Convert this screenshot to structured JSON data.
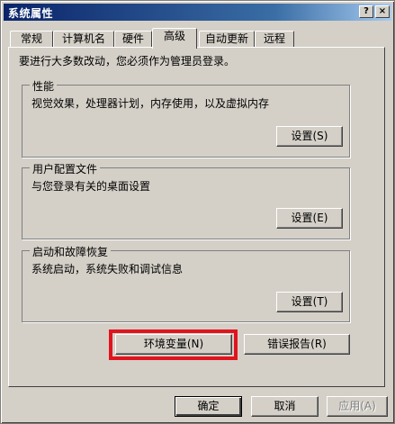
{
  "window": {
    "title": "系统属性",
    "help_glyph": "?",
    "close_glyph": "×"
  },
  "tabs": [
    {
      "label": "常规"
    },
    {
      "label": "计算机名"
    },
    {
      "label": "硬件"
    },
    {
      "label": "高级"
    },
    {
      "label": "自动更新"
    },
    {
      "label": "远程"
    }
  ],
  "active_tab": "高级",
  "notice": "要进行大多数改动，您必须作为管理员登录。",
  "groups": {
    "performance": {
      "title": "性能",
      "description": "视觉效果，处理器计划，内存使用，以及虚拟内存",
      "button": "设置(S)"
    },
    "user_profiles": {
      "title": "用户配置文件",
      "description": "与您登录有关的桌面设置",
      "button": "设置(E)"
    },
    "startup_recovery": {
      "title": "启动和故障恢复",
      "description": "系统启动，系统失败和调试信息",
      "button": "设置(T)"
    }
  },
  "buttons": {
    "env_vars": "环境变量(N)",
    "error_report": "错误报告(R)",
    "ok": "确定",
    "cancel": "取消",
    "apply": "应用(A)"
  },
  "colors": {
    "highlight": "#e0141e",
    "titlebar": "#0a246a",
    "face": "#d4d0c8"
  }
}
